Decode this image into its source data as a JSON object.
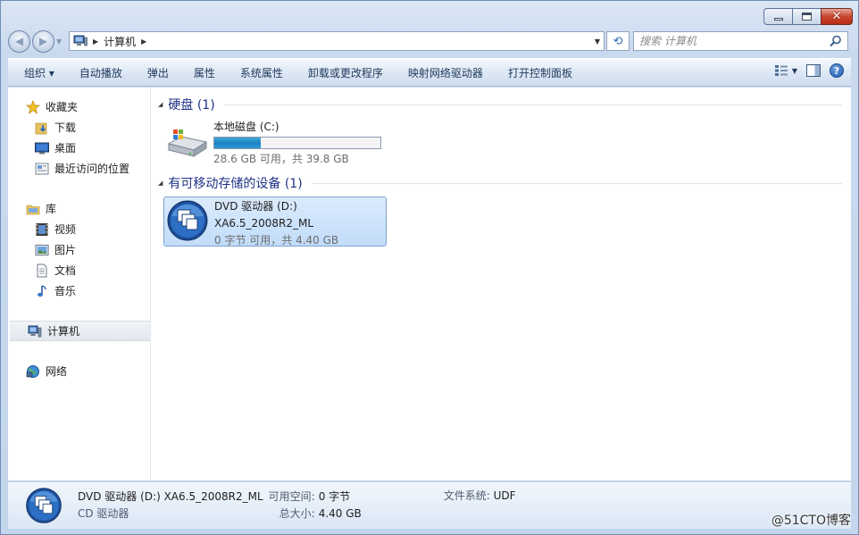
{
  "window": {
    "controls": {
      "minimize_icon": "minimize-icon",
      "maximize_icon": "maximize-icon",
      "close_icon": "close-icon",
      "close_glyph": "✕"
    }
  },
  "address_bar": {
    "breadcrumb": [
      "计算机"
    ],
    "search_placeholder": "搜索 计算机"
  },
  "toolbar": {
    "items": [
      "组织 ▾",
      "自动播放",
      "弹出",
      "属性",
      "系统属性",
      "卸载或更改程序",
      "映射网络驱动器",
      "打开控制面板"
    ],
    "help": "?"
  },
  "sidebar": {
    "favorites": {
      "label": "收藏夹",
      "items": [
        "下载",
        "桌面",
        "最近访问的位置"
      ]
    },
    "libraries": {
      "label": "库",
      "items": [
        "视频",
        "图片",
        "文档",
        "音乐"
      ]
    },
    "computer": "计算机",
    "network": "网络"
  },
  "main": {
    "groups": [
      {
        "title": "硬盘 (1)",
        "drives": [
          {
            "name": "本地磁盘 (C:)",
            "usage": "28.6 GB 可用，共 39.8 GB",
            "used_fraction": 0.28
          }
        ]
      },
      {
        "title": "有可移动存储的设备 (1)",
        "drives": [
          {
            "name": "DVD 驱动器 (D:)",
            "label": "XA6.5_2008R2_ML",
            "usage": "0 字节 可用，共 4.40 GB"
          }
        ]
      }
    ]
  },
  "details": {
    "title": "DVD 驱动器 (D:) XA6.5_2008R2_ML",
    "type": "CD 驱动器",
    "free_label": "可用空间:",
    "free_value": "0 字节",
    "total_label": "总大小:",
    "total_value": "4.40 GB",
    "fs_label": "文件系统:",
    "fs_value": "UDF"
  },
  "watermark": "@51CTO博客",
  "colors": {
    "accent": "#1d83c6",
    "group_title": "#1e3287",
    "selection": "#c1dcfa"
  }
}
